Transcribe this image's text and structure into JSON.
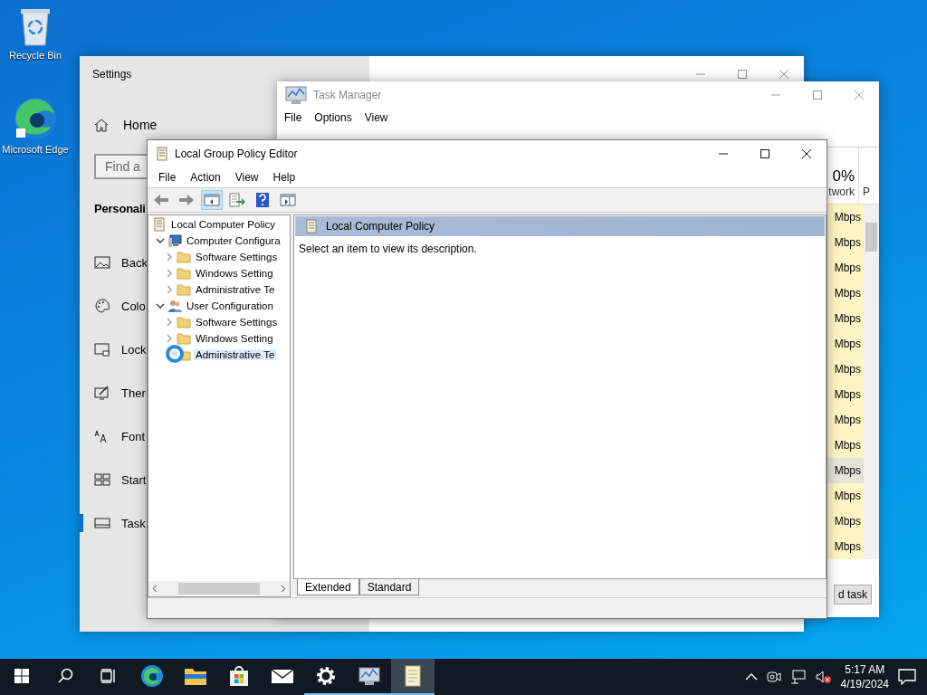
{
  "desktop_icons": [
    {
      "label": "Recycle Bin",
      "kind": "recycle"
    },
    {
      "label": "Microsoft Edge",
      "kind": "edge"
    }
  ],
  "settings": {
    "title": "Settings",
    "home": "Home",
    "search": {
      "placeholder": "Find a"
    },
    "section": "Personali",
    "nav": [
      {
        "label": "Back",
        "kind": "image",
        "selected": false
      },
      {
        "label": "Colo",
        "kind": "palette",
        "selected": false
      },
      {
        "label": "Lock",
        "kind": "lock",
        "selected": false
      },
      {
        "label": "Ther",
        "kind": "theme",
        "selected": false
      },
      {
        "label": "Font",
        "kind": "font",
        "selected": false
      },
      {
        "label": "Start",
        "kind": "start",
        "selected": false
      },
      {
        "label": "Task",
        "kind": "taskbar",
        "selected": true
      }
    ]
  },
  "task_manager": {
    "title": "Task Manager",
    "menu": [
      "File",
      "Options",
      "View"
    ],
    "column": {
      "value": "0%",
      "label": "twork",
      "next_label": "P"
    },
    "rows": [
      {
        "network": "Mbps",
        "selected": false
      },
      {
        "network": "Mbps",
        "selected": false
      },
      {
        "network": "Mbps",
        "selected": false
      },
      {
        "network": "Mbps",
        "selected": false
      },
      {
        "network": "Mbps",
        "selected": false
      },
      {
        "network": "Mbps",
        "selected": false
      },
      {
        "network": "Mbps",
        "selected": false
      },
      {
        "network": "Mbps",
        "selected": false
      },
      {
        "network": "Mbps",
        "selected": false
      },
      {
        "network": "Mbps",
        "selected": false
      },
      {
        "network": "Mbps",
        "selected": true
      },
      {
        "network": "Mbps",
        "selected": false
      },
      {
        "network": "Mbps",
        "selected": false
      },
      {
        "network": "Mbps",
        "selected": false
      }
    ],
    "button": "d task"
  },
  "gpe": {
    "title": "Local Group Policy Editor",
    "menu": [
      "File",
      "Action",
      "View",
      "Help"
    ],
    "toolbar": [
      {
        "kind": "back",
        "pressed": false
      },
      {
        "kind": "forward",
        "pressed": false
      },
      {
        "kind": "tree",
        "pressed": true
      },
      {
        "kind": "export",
        "pressed": false
      },
      {
        "kind": "help",
        "pressed": false
      },
      {
        "kind": "pane",
        "pressed": false
      }
    ],
    "tree": {
      "label": "Local Computer Policy",
      "kind": "policy",
      "selected": false,
      "children": [
        {
          "label": "Computer Configura",
          "kind": "computer",
          "expanded": true,
          "selected": false,
          "children": [
            {
              "label": "Software Settings",
              "kind": "folder",
              "expanded": false,
              "selected": false
            },
            {
              "label": "Windows Setting",
              "kind": "folder",
              "expanded": false,
              "selected": false
            },
            {
              "label": "Administrative Te",
              "kind": "folder",
              "expanded": false,
              "selected": false
            }
          ]
        },
        {
          "label": "User Configuration",
          "kind": "users",
          "expanded": true,
          "selected": false,
          "children": [
            {
              "label": "Software Settings",
              "kind": "folder",
              "expanded": false,
              "selected": false
            },
            {
              "label": "Windows Setting",
              "kind": "folder",
              "expanded": false,
              "selected": false
            },
            {
              "label": "Administrative Te",
              "kind": "folder",
              "selected": true
            }
          ]
        }
      ]
    },
    "header": "Local Computer Policy",
    "description": "Select an item to view its description.",
    "tabs": [
      {
        "label": "Extended",
        "selected": true
      },
      {
        "label": "Standard",
        "selected": false
      }
    ]
  },
  "taskbar": {
    "apps": [
      {
        "kind": "edge",
        "running": false,
        "active": false
      },
      {
        "kind": "explorer",
        "running": false,
        "active": false
      },
      {
        "kind": "store",
        "running": false,
        "active": false
      },
      {
        "kind": "mail",
        "running": false,
        "active": false
      },
      {
        "kind": "settings",
        "running": true,
        "active": false
      },
      {
        "kind": "taskmgr",
        "running": true,
        "active": false
      },
      {
        "kind": "policy",
        "running": true,
        "active": true
      }
    ],
    "time": "5:17 AM",
    "date": "4/19/2024"
  }
}
